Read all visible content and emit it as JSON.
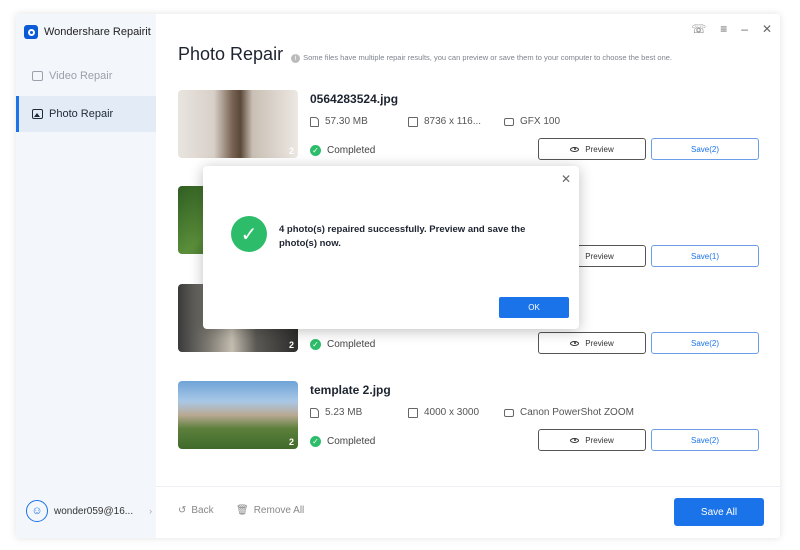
{
  "app": {
    "title": "Wondershare Repairit"
  },
  "sidebar": {
    "items": [
      {
        "label": "Video Repair",
        "icon": "video-icon",
        "active": false
      },
      {
        "label": "Photo Repair",
        "icon": "photo-icon",
        "active": true
      }
    ],
    "user": {
      "name": "wonder059@16..."
    }
  },
  "page": {
    "title": "Photo Repair",
    "note": "Some files have multiple repair results, you can preview or save them to your computer to choose the best one."
  },
  "files": [
    {
      "name": "0564283524.jpg",
      "size": "57.30  MB",
      "resolution": "8736 x 116...",
      "camera": "GFX 100",
      "status": "Completed",
      "count": "2",
      "preview_label": "Preview",
      "save_label": "Save(2)"
    },
    {
      "name": "",
      "size": "",
      "resolution": "",
      "camera": "",
      "status": "",
      "count": "",
      "preview_label": "Preview",
      "save_label": "Save(1)"
    },
    {
      "name": "",
      "size": "",
      "resolution": "",
      "camera": "",
      "status": "Completed",
      "count": "2",
      "preview_label": "Preview",
      "save_label": "Save(2)"
    },
    {
      "name": "template 2.jpg",
      "size": "5.23  MB",
      "resolution": "4000 x 3000",
      "camera": "Canon PowerShot ZOOM",
      "status": "Completed",
      "count": "2",
      "preview_label": "Preview",
      "save_label": "Save(2)"
    }
  ],
  "footer": {
    "back_label": "Back",
    "remove_label": "Remove All",
    "save_all_label": "Save All"
  },
  "dialog": {
    "message": "4 photo(s) repaired successfully. Preview and save the photo(s) now.",
    "ok_label": "OK"
  },
  "colors": {
    "accent": "#1a73e8",
    "success": "#2dbd6a",
    "sidebar_bg": "#f3f6fa"
  }
}
